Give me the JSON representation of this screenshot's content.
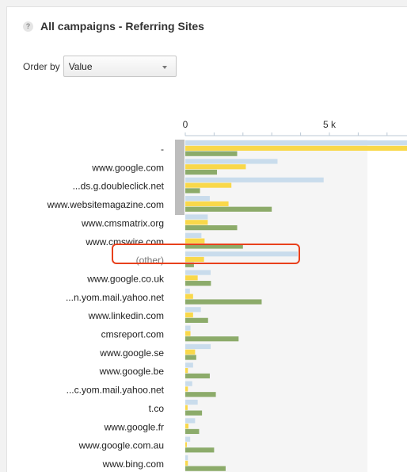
{
  "panel": {
    "help_icon": "question-mark-icon",
    "title": "All campaigns - Referring Sites"
  },
  "order_by": {
    "label": "Order by",
    "selected": "Value",
    "arrow_icon": "dropdown-arrow-icon"
  },
  "colors": {
    "series_a": "#c9dcec",
    "series_b": "#f9d84a",
    "series_c": "#8cab6a",
    "highlight": "#e8401c"
  },
  "chart_data": {
    "type": "bar",
    "orientation": "horizontal",
    "x_ticks": [
      "0",
      "5 k"
    ],
    "x_tick_values": [
      0,
      5000
    ],
    "categories": [
      "-",
      "www.google.com",
      "...ds.g.doubleclick.net",
      "www.websitemagazine.com",
      "www.cmsmatrix.org",
      "www.cmswire.com",
      "(other)",
      "www.google.co.uk",
      "...n.yom.mail.yahoo.net",
      "www.linkedin.com",
      "cmsreport.com",
      "www.google.se",
      "www.google.be",
      "...c.yom.mail.yahoo.net",
      "t.co",
      "www.google.fr",
      "www.google.com.au",
      "www.bing.com"
    ],
    "highlighted_category": "(other)",
    "series": [
      {
        "values": [
          8600,
          3200,
          4800,
          850,
          780,
          560,
          3900,
          880,
          160,
          540,
          180,
          880,
          270,
          240,
          430,
          340,
          170,
          90
        ]
      },
      {
        "values": [
          8700,
          2100,
          1600,
          1500,
          780,
          670,
          650,
          430,
          270,
          270,
          180,
          340,
          90,
          90,
          80,
          110,
          55,
          90
        ]
      },
      {
        "values": [
          1800,
          1100,
          510,
          3000,
          1800,
          2000,
          300,
          890,
          2650,
          790,
          1850,
          380,
          850,
          1060,
          580,
          480,
          1000,
          1400
        ]
      }
    ]
  }
}
